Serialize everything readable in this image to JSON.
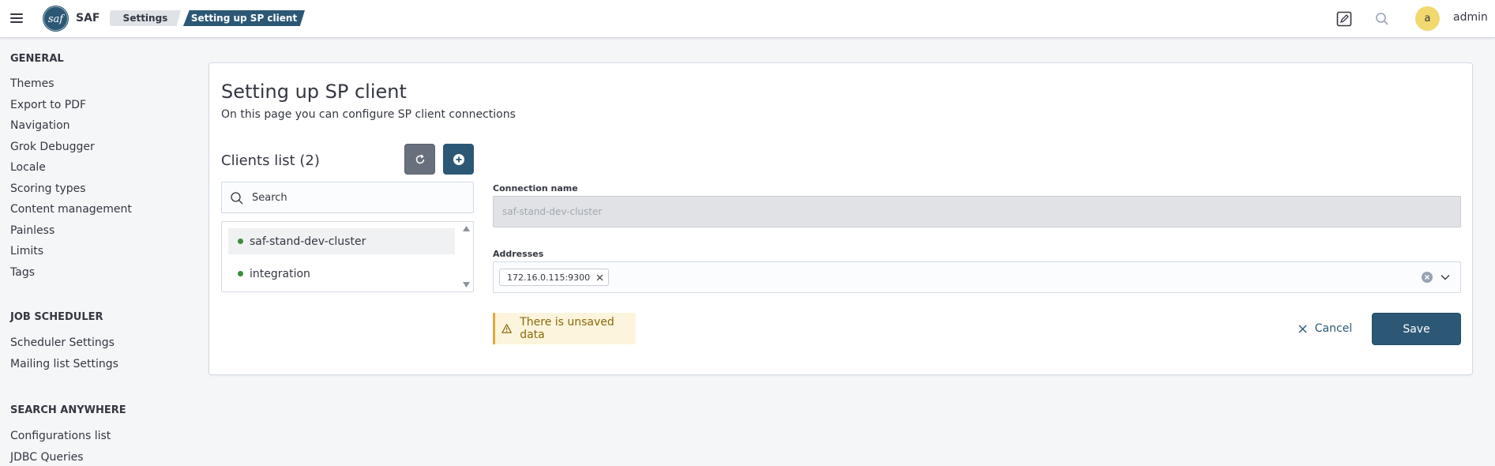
{
  "header": {
    "app_name": "SAF",
    "logo_text": "saf",
    "breadcrumbs": [
      {
        "label": "Settings"
      },
      {
        "label": "Setting up SP client"
      }
    ],
    "user_initial": "a",
    "username": "admin",
    "icons": [
      "menu-icon",
      "edit-icon",
      "search-icon"
    ]
  },
  "sidebar": {
    "sections": [
      {
        "title": "GENERAL",
        "items": [
          "Themes",
          "Export to PDF",
          "Navigation",
          "Grok Debugger",
          "Locale",
          "Scoring types",
          "Content management",
          "Painless",
          "Limits",
          "Tags"
        ]
      },
      {
        "title": "JOB SCHEDULER",
        "items": [
          "Scheduler Settings",
          "Mailing list Settings"
        ]
      },
      {
        "title": "SEARCH ANYWHERE",
        "items": [
          "Configurations list",
          "JDBC Queries"
        ]
      }
    ]
  },
  "main": {
    "title": "Setting up SP client",
    "subtitle": "On this page you can configure SP client connections",
    "clients_title": "Clients list (2)",
    "search": {
      "placeholder": "Search",
      "value": ""
    },
    "clients": [
      {
        "name": "saf-stand-dev-cluster",
        "selected": true,
        "status_color": "#3c8c3c"
      },
      {
        "name": "integration",
        "selected": false,
        "status_color": "#3c8c3c"
      }
    ],
    "form": {
      "connection_label": "Connection name",
      "connection_value": "saf-stand-dev-cluster",
      "addresses_label": "Addresses",
      "addresses": [
        "172.16.0.115:9300"
      ]
    },
    "warning": "There is unsaved data",
    "cancel_label": "Cancel",
    "save_label": "Save"
  },
  "colors": {
    "primary": "#2c5876",
    "secondary": "#69707d",
    "warning_bg": "#fcf4dd",
    "warning_border": "#e5a83a",
    "avatar": "#f1d86f",
    "status_ok": "#3c8c3c"
  }
}
